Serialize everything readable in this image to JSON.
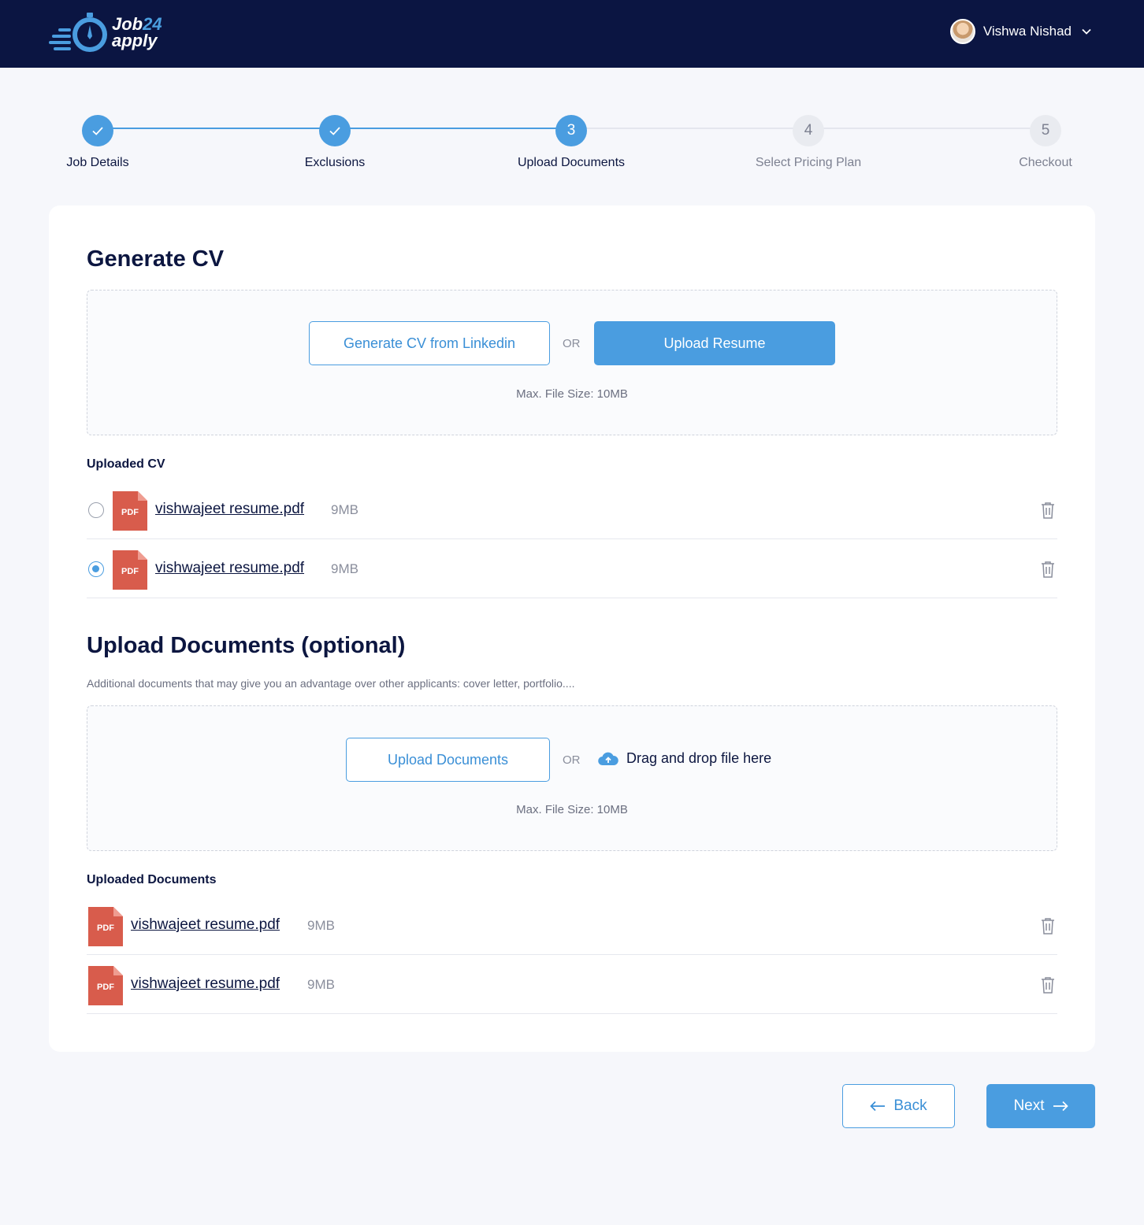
{
  "header": {
    "logo": {
      "word1": "Job",
      "number": "24",
      "word2": "apply"
    },
    "user": {
      "name": "Vishwa Nishad"
    }
  },
  "stepper": {
    "steps": [
      {
        "label": "Job Details",
        "number": "1",
        "state": "done"
      },
      {
        "label": "Exclusions",
        "number": "2",
        "state": "done"
      },
      {
        "label": "Upload Documents",
        "number": "3",
        "state": "active"
      },
      {
        "label": "Select Pricing Plan",
        "number": "4",
        "state": "todo"
      },
      {
        "label": "Checkout",
        "number": "5",
        "state": "todo"
      }
    ]
  },
  "generate_cv": {
    "title": "Generate CV",
    "linkedin_button": "Generate CV from Linkedin",
    "or": "OR",
    "upload_button": "Upload Resume",
    "max_size": "Max. File Size: 10MB",
    "list_title": "Uploaded CV",
    "files": [
      {
        "name": "vishwajeet resume.pdf",
        "size": "9MB",
        "selected": false,
        "type": "PDF"
      },
      {
        "name": "vishwajeet resume.pdf",
        "size": "9MB",
        "selected": true,
        "type": "PDF"
      }
    ]
  },
  "upload_docs": {
    "title": "Upload Documents (optional)",
    "subtitle": "Additional documents that may give you an advantage over other applicants: cover letter, portfolio....",
    "upload_button": "Upload Documents",
    "or": "OR",
    "drag_text": "Drag and drop file here",
    "max_size": "Max. File Size: 10MB",
    "list_title": "Uploaded Documents",
    "files": [
      {
        "name": "vishwajeet resume.pdf",
        "size": "9MB",
        "type": "PDF"
      },
      {
        "name": "vishwajeet resume.pdf",
        "size": "9MB",
        "type": "PDF"
      }
    ]
  },
  "footer": {
    "back": "Back",
    "next": "Next"
  },
  "colors": {
    "navy": "#0b1542",
    "accent": "#4a9de0",
    "pdf_red": "#d85c4c"
  }
}
